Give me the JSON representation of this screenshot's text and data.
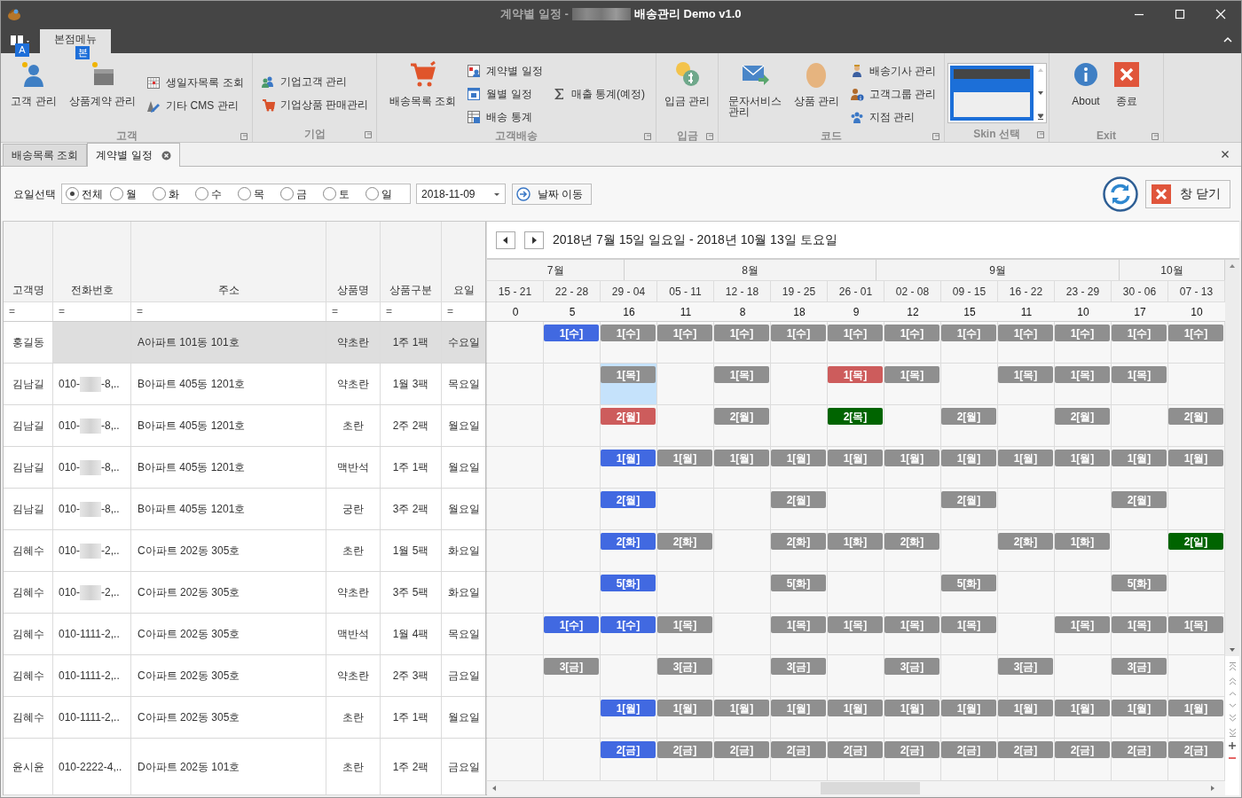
{
  "window": {
    "title_parts": [
      "계약별 일정 -",
      "배송관리 Demo v1.0"
    ]
  },
  "ribbon": {
    "app_menu_keytip": "A",
    "tabs": [
      {
        "label": "본점메뉴",
        "selected": true,
        "keytip": "본"
      }
    ],
    "groups": [
      {
        "label": "고객",
        "columns": [
          [
            {
              "kind": "large",
              "label": "고객 관리"
            }
          ],
          [
            {
              "kind": "large",
              "label": "상품계약 관리"
            }
          ],
          [
            {
              "kind": "small",
              "label": "생일자목록 조회"
            },
            {
              "kind": "small",
              "label": "기타 CMS 관리"
            }
          ]
        ]
      },
      {
        "label": "기업",
        "columns": [
          [
            {
              "kind": "small",
              "label": "기업고객 관리"
            },
            {
              "kind": "small",
              "label": "기업상품 판매관리"
            }
          ]
        ]
      },
      {
        "label": "고객배송",
        "columns": [
          [
            {
              "kind": "large",
              "label": "배송목록 조회"
            }
          ],
          [
            {
              "kind": "small",
              "label": "계약별 일정"
            },
            {
              "kind": "small",
              "label": "월별 일정"
            },
            {
              "kind": "small",
              "label": "배송 통계"
            }
          ],
          [
            {
              "kind": "small",
              "label": "매출 통계(예정)"
            }
          ]
        ]
      },
      {
        "label": "입금",
        "columns": [
          [
            {
              "kind": "large",
              "label": "입금 관리"
            }
          ]
        ]
      },
      {
        "label": "코드",
        "columns": [
          [
            {
              "kind": "large",
              "label": "문자서비스\n관리"
            }
          ],
          [
            {
              "kind": "large",
              "label": "상품 관리"
            }
          ],
          [
            {
              "kind": "small",
              "label": "배송기사 관리"
            },
            {
              "kind": "small",
              "label": "고객그룹 관리"
            },
            {
              "kind": "small",
              "label": "지점 관리"
            }
          ]
        ]
      },
      {
        "label": "Skin 선택",
        "columns": [
          [
            {
              "kind": "skin"
            }
          ]
        ]
      },
      {
        "label": "Exit",
        "columns": [
          [
            {
              "kind": "large",
              "label": "About"
            }
          ],
          [
            {
              "kind": "large",
              "label": "종료"
            }
          ]
        ]
      }
    ]
  },
  "doc_tabs": [
    {
      "label": "배송목록 조회",
      "selected": false,
      "closable": false
    },
    {
      "label": "계약별 일정",
      "selected": true,
      "closable": true
    }
  ],
  "toolbar": {
    "day_label": "요일선택",
    "days": [
      {
        "label": "전체",
        "checked": true
      },
      {
        "label": "월",
        "checked": false
      },
      {
        "label": "화",
        "checked": false
      },
      {
        "label": "수",
        "checked": false
      },
      {
        "label": "목",
        "checked": false
      },
      {
        "label": "금",
        "checked": false
      },
      {
        "label": "토",
        "checked": false
      },
      {
        "label": "일",
        "checked": false
      }
    ],
    "date": "2018-11-09",
    "go_button": "날짜 이동",
    "close_button": "창 닫기"
  },
  "table": {
    "columns": [
      {
        "label": "고객명",
        "filter": "="
      },
      {
        "label": "전화번호",
        "filter": "="
      },
      {
        "label": "주소",
        "filter": "="
      },
      {
        "label": "상품명",
        "filter": "="
      },
      {
        "label": "상품구분",
        "filter": "="
      },
      {
        "label": "요일",
        "filter": "="
      }
    ],
    "rows": [
      {
        "selected": true,
        "name": "홍길동",
        "address": "A아파트 101동 101호",
        "product": "약초란",
        "plan": "1주 1팩",
        "day": "수요일"
      },
      {
        "selected": false,
        "name": "김남길",
        "phone": [
          "010-",
          "-8,.."
        ],
        "address": "B아파트 405동 1201호",
        "product": "약초란",
        "plan": "1월 3팩",
        "day": "목요일"
      },
      {
        "selected": false,
        "name": "김남길",
        "phone": [
          "010-",
          "-8,.."
        ],
        "address": "B아파트 405동 1201호",
        "product": "초란",
        "plan": "2주 2팩",
        "day": "월요일"
      },
      {
        "selected": false,
        "name": "김남길",
        "phone": [
          "010-",
          "-8,.."
        ],
        "address": "B아파트 405동 1201호",
        "product": "맥반석",
        "plan": "1주 1팩",
        "day": "월요일"
      },
      {
        "selected": false,
        "name": "김남길",
        "phone": [
          "010-",
          "-8,.."
        ],
        "address": "B아파트 405동 1201호",
        "product": "궁란",
        "plan": "3주 2팩",
        "day": "월요일"
      },
      {
        "selected": false,
        "name": "김혜수",
        "phone": [
          "010-",
          "-2,.."
        ],
        "address": "C아파트 202동 305호",
        "product": "초란",
        "plan": "1월 5팩",
        "day": "화요일"
      },
      {
        "selected": false,
        "name": "김혜수",
        "phone": [
          "010-",
          "-2,.."
        ],
        "address": "C아파트 202동 305호",
        "product": "약초란",
        "plan": "3주 5팩",
        "day": "화요일"
      },
      {
        "selected": false,
        "name": "김혜수",
        "phone": [
          "010-1111-2,.."
        ],
        "address": "C아파트 202동 305호",
        "product": "맥반석",
        "plan": "1월 4팩",
        "day": "목요일"
      },
      {
        "selected": false,
        "name": "김혜수",
        "phone": [
          "010-1111-2,.."
        ],
        "address": "C아파트 202동 305호",
        "product": "약초란",
        "plan": "2주 3팩",
        "day": "금요일"
      },
      {
        "selected": false,
        "name": "김혜수",
        "phone": [
          "010-1111-2,.."
        ],
        "address": "C아파트 202동 305호",
        "product": "초란",
        "plan": "1주 1팩",
        "day": "월요일"
      },
      {
        "selected": false,
        "name": "윤시윤",
        "phone": [
          "010-2222-4,.."
        ],
        "address": "D아파트 202동 101호",
        "product": "초란",
        "plan": "1주 2팩",
        "day": "금요일"
      }
    ]
  },
  "schedule": {
    "range": "2018년 7월 15일 일요일 - 2018년 10월 13일 토요일",
    "months": [
      "7월",
      "8월",
      "9월",
      "10월"
    ],
    "weeks": [
      {
        "label": "15 - 21",
        "count": "0"
      },
      {
        "label": "22 - 28",
        "count": "5"
      },
      {
        "label": "29 - 04",
        "count": "16"
      },
      {
        "label": "05 - 11",
        "count": "11"
      },
      {
        "label": "12 - 18",
        "count": "8"
      },
      {
        "label": "19 - 25",
        "count": "18"
      },
      {
        "label": "26 - 01",
        "count": "9"
      },
      {
        "label": "02 - 08",
        "count": "12"
      },
      {
        "label": "09 - 15",
        "count": "15"
      },
      {
        "label": "16 - 22",
        "count": "11"
      },
      {
        "label": "23 - 29",
        "count": "10"
      },
      {
        "label": "30 - 06",
        "count": "17"
      },
      {
        "label": "07 - 13",
        "count": "10"
      }
    ],
    "rows": [
      {
        "cells": [
          {
            "kind": "empty",
            "selected": false
          },
          {
            "kind": "entry",
            "label": "1[수]",
            "color": "#4169e1",
            "selected": false
          },
          {
            "kind": "entry",
            "label": "1[수]",
            "color": "#8f8f8f",
            "selected": false
          },
          {
            "kind": "entry",
            "label": "1[수]",
            "color": "#8f8f8f",
            "selected": false
          },
          {
            "kind": "entry",
            "label": "1[수]",
            "color": "#8f8f8f",
            "selected": false
          },
          {
            "kind": "entry",
            "label": "1[수]",
            "color": "#8f8f8f",
            "selected": false
          },
          {
            "kind": "entry",
            "label": "1[수]",
            "color": "#8f8f8f",
            "selected": false
          },
          {
            "kind": "entry",
            "label": "1[수]",
            "color": "#8f8f8f",
            "selected": false
          },
          {
            "kind": "entry",
            "label": "1[수]",
            "color": "#8f8f8f",
            "selected": false
          },
          {
            "kind": "entry",
            "label": "1[수]",
            "color": "#8f8f8f",
            "selected": false
          },
          {
            "kind": "entry",
            "label": "1[수]",
            "color": "#8f8f8f",
            "selected": false
          },
          {
            "kind": "entry",
            "label": "1[수]",
            "color": "#8f8f8f",
            "selected": false
          },
          {
            "kind": "entry",
            "label": "1[수]",
            "color": "#8f8f8f",
            "selected": false
          }
        ]
      },
      {
        "cells": [
          {
            "kind": "empty",
            "selected": false
          },
          {
            "kind": "empty",
            "selected": false
          },
          {
            "kind": "entry",
            "label": "1[목]",
            "color": "#8f8f8f",
            "selected": true
          },
          {
            "kind": "empty",
            "selected": false
          },
          {
            "kind": "entry",
            "label": "1[목]",
            "color": "#8f8f8f",
            "selected": false
          },
          {
            "kind": "empty",
            "selected": false
          },
          {
            "kind": "entry",
            "label": "1[목]",
            "color": "#cd5c5c",
            "selected": false
          },
          {
            "kind": "entry",
            "label": "1[목]",
            "color": "#8f8f8f",
            "selected": false
          },
          {
            "kind": "empty",
            "selected": false
          },
          {
            "kind": "entry",
            "label": "1[목]",
            "color": "#8f8f8f",
            "selected": false
          },
          {
            "kind": "entry",
            "label": "1[목]",
            "color": "#8f8f8f",
            "selected": false
          },
          {
            "kind": "entry",
            "label": "1[목]",
            "color": "#8f8f8f",
            "selected": false
          },
          {
            "kind": "empty",
            "selected": false
          }
        ]
      },
      {
        "cells": [
          {
            "kind": "empty",
            "selected": false
          },
          {
            "kind": "empty",
            "selected": false
          },
          {
            "kind": "entry",
            "label": "2[월]",
            "color": "#cd5c5c",
            "selected": false
          },
          {
            "kind": "empty",
            "selected": false
          },
          {
            "kind": "entry",
            "label": "2[월]",
            "color": "#8f8f8f",
            "selected": false
          },
          {
            "kind": "empty",
            "selected": false
          },
          {
            "kind": "entry",
            "label": "2[목]",
            "color": "#006400",
            "selected": false
          },
          {
            "kind": "empty",
            "selected": false
          },
          {
            "kind": "entry",
            "label": "2[월]",
            "color": "#8f8f8f",
            "selected": false
          },
          {
            "kind": "empty",
            "selected": false
          },
          {
            "kind": "entry",
            "label": "2[월]",
            "color": "#8f8f8f",
            "selected": false
          },
          {
            "kind": "empty",
            "selected": false
          },
          {
            "kind": "entry",
            "label": "2[월]",
            "color": "#8f8f8f",
            "selected": false
          }
        ]
      },
      {
        "cells": [
          {
            "kind": "empty",
            "selected": false
          },
          {
            "kind": "empty",
            "selected": false
          },
          {
            "kind": "entry",
            "label": "1[월]",
            "color": "#4169e1",
            "selected": false
          },
          {
            "kind": "entry",
            "label": "1[월]",
            "color": "#8f8f8f",
            "selected": false
          },
          {
            "kind": "entry",
            "label": "1[월]",
            "color": "#8f8f8f",
            "selected": false
          },
          {
            "kind": "entry",
            "label": "1[월]",
            "color": "#8f8f8f",
            "selected": false
          },
          {
            "kind": "entry",
            "label": "1[월]",
            "color": "#8f8f8f",
            "selected": false
          },
          {
            "kind": "entry",
            "label": "1[월]",
            "color": "#8f8f8f",
            "selected": false
          },
          {
            "kind": "entry",
            "label": "1[월]",
            "color": "#8f8f8f",
            "selected": false
          },
          {
            "kind": "entry",
            "label": "1[월]",
            "color": "#8f8f8f",
            "selected": false
          },
          {
            "kind": "entry",
            "label": "1[월]",
            "color": "#8f8f8f",
            "selected": false
          },
          {
            "kind": "entry",
            "label": "1[월]",
            "color": "#8f8f8f",
            "selected": false
          },
          {
            "kind": "entry",
            "label": "1[월]",
            "color": "#8f8f8f",
            "selected": false
          }
        ]
      },
      {
        "cells": [
          {
            "kind": "empty",
            "selected": false
          },
          {
            "kind": "empty",
            "selected": false
          },
          {
            "kind": "entry",
            "label": "2[월]",
            "color": "#4169e1",
            "selected": false
          },
          {
            "kind": "empty",
            "selected": false
          },
          {
            "kind": "empty",
            "selected": false
          },
          {
            "kind": "entry",
            "label": "2[월]",
            "color": "#8f8f8f",
            "selected": false
          },
          {
            "kind": "empty",
            "selected": false
          },
          {
            "kind": "empty",
            "selected": false
          },
          {
            "kind": "entry",
            "label": "2[월]",
            "color": "#8f8f8f",
            "selected": false
          },
          {
            "kind": "empty",
            "selected": false
          },
          {
            "kind": "empty",
            "selected": false
          },
          {
            "kind": "entry",
            "label": "2[월]",
            "color": "#8f8f8f",
            "selected": false
          },
          {
            "kind": "empty",
            "selected": false
          }
        ]
      },
      {
        "cells": [
          {
            "kind": "empty",
            "selected": false
          },
          {
            "kind": "empty",
            "selected": false
          },
          {
            "kind": "entry",
            "label": "2[화]",
            "color": "#4169e1",
            "selected": false
          },
          {
            "kind": "entry",
            "label": "2[화]",
            "color": "#8f8f8f",
            "selected": false
          },
          {
            "kind": "empty",
            "selected": false
          },
          {
            "kind": "entry",
            "label": "2[화]",
            "color": "#8f8f8f",
            "selected": false
          },
          {
            "kind": "entry",
            "label": "1[화]",
            "color": "#8f8f8f",
            "selected": false
          },
          {
            "kind": "entry",
            "label": "2[화]",
            "color": "#8f8f8f",
            "selected": false
          },
          {
            "kind": "empty",
            "selected": false
          },
          {
            "kind": "entry",
            "label": "2[화]",
            "color": "#8f8f8f",
            "selected": false
          },
          {
            "kind": "entry",
            "label": "1[화]",
            "color": "#8f8f8f",
            "selected": false
          },
          {
            "kind": "empty",
            "selected": false
          },
          {
            "kind": "entry",
            "label": "2[일]",
            "color": "#006400",
            "selected": false
          }
        ]
      },
      {
        "cells": [
          {
            "kind": "empty",
            "selected": false
          },
          {
            "kind": "empty",
            "selected": false
          },
          {
            "kind": "entry",
            "label": "5[화]",
            "color": "#4169e1",
            "selected": false
          },
          {
            "kind": "empty",
            "selected": false
          },
          {
            "kind": "empty",
            "selected": false
          },
          {
            "kind": "entry",
            "label": "5[화]",
            "color": "#8f8f8f",
            "selected": false
          },
          {
            "kind": "empty",
            "selected": false
          },
          {
            "kind": "empty",
            "selected": false
          },
          {
            "kind": "entry",
            "label": "5[화]",
            "color": "#8f8f8f",
            "selected": false
          },
          {
            "kind": "empty",
            "selected": false
          },
          {
            "kind": "empty",
            "selected": false
          },
          {
            "kind": "entry",
            "label": "5[화]",
            "color": "#8f8f8f",
            "selected": false
          },
          {
            "kind": "empty",
            "selected": false
          }
        ]
      },
      {
        "cells": [
          {
            "kind": "empty",
            "selected": false
          },
          {
            "kind": "entry",
            "label": "1[수]",
            "color": "#4169e1",
            "selected": false
          },
          {
            "kind": "entry",
            "label": "1[수]",
            "color": "#4169e1",
            "selected": false
          },
          {
            "kind": "entry",
            "label": "1[목]",
            "color": "#8f8f8f",
            "selected": false
          },
          {
            "kind": "empty",
            "selected": false
          },
          {
            "kind": "entry",
            "label": "1[목]",
            "color": "#8f8f8f",
            "selected": false
          },
          {
            "kind": "entry",
            "label": "1[목]",
            "color": "#8f8f8f",
            "selected": false
          },
          {
            "kind": "entry",
            "label": "1[목]",
            "color": "#8f8f8f",
            "selected": false
          },
          {
            "kind": "entry",
            "label": "1[목]",
            "color": "#8f8f8f",
            "selected": false
          },
          {
            "kind": "empty",
            "selected": false
          },
          {
            "kind": "entry",
            "label": "1[목]",
            "color": "#8f8f8f",
            "selected": false
          },
          {
            "kind": "entry",
            "label": "1[목]",
            "color": "#8f8f8f",
            "selected": false
          },
          {
            "kind": "entry",
            "label": "1[목]",
            "color": "#8f8f8f",
            "selected": false
          }
        ]
      },
      {
        "cells": [
          {
            "kind": "empty",
            "selected": false
          },
          {
            "kind": "entry",
            "label": "3[금]",
            "color": "#8f8f8f",
            "selected": false
          },
          {
            "kind": "empty",
            "selected": false
          },
          {
            "kind": "entry",
            "label": "3[금]",
            "color": "#8f8f8f",
            "selected": false
          },
          {
            "kind": "empty",
            "selected": false
          },
          {
            "kind": "entry",
            "label": "3[금]",
            "color": "#8f8f8f",
            "selected": false
          },
          {
            "kind": "empty",
            "selected": false
          },
          {
            "kind": "entry",
            "label": "3[금]",
            "color": "#8f8f8f",
            "selected": false
          },
          {
            "kind": "empty",
            "selected": false
          },
          {
            "kind": "entry",
            "label": "3[금]",
            "color": "#8f8f8f",
            "selected": false
          },
          {
            "kind": "empty",
            "selected": false
          },
          {
            "kind": "entry",
            "label": "3[금]",
            "color": "#8f8f8f",
            "selected": false
          },
          {
            "kind": "empty",
            "selected": false
          }
        ]
      },
      {
        "cells": [
          {
            "kind": "empty",
            "selected": false
          },
          {
            "kind": "empty",
            "selected": false
          },
          {
            "kind": "entry",
            "label": "1[월]",
            "color": "#4169e1",
            "selected": false
          },
          {
            "kind": "entry",
            "label": "1[월]",
            "color": "#8f8f8f",
            "selected": false
          },
          {
            "kind": "entry",
            "label": "1[월]",
            "color": "#8f8f8f",
            "selected": false
          },
          {
            "kind": "entry",
            "label": "1[월]",
            "color": "#8f8f8f",
            "selected": false
          },
          {
            "kind": "entry",
            "label": "1[월]",
            "color": "#8f8f8f",
            "selected": false
          },
          {
            "kind": "entry",
            "label": "1[월]",
            "color": "#8f8f8f",
            "selected": false
          },
          {
            "kind": "entry",
            "label": "1[월]",
            "color": "#8f8f8f",
            "selected": false
          },
          {
            "kind": "entry",
            "label": "1[월]",
            "color": "#8f8f8f",
            "selected": false
          },
          {
            "kind": "entry",
            "label": "1[월]",
            "color": "#8f8f8f",
            "selected": false
          },
          {
            "kind": "entry",
            "label": "1[월]",
            "color": "#8f8f8f",
            "selected": false
          },
          {
            "kind": "entry",
            "label": "1[월]",
            "color": "#8f8f8f",
            "selected": false
          }
        ]
      },
      {
        "cells": [
          {
            "kind": "empty",
            "selected": false
          },
          {
            "kind": "empty",
            "selected": false
          },
          {
            "kind": "entry",
            "label": "2[금]",
            "color": "#4169e1",
            "selected": false
          },
          {
            "kind": "entry",
            "label": "2[금]",
            "color": "#8f8f8f",
            "selected": false
          },
          {
            "kind": "entry",
            "label": "2[금]",
            "color": "#8f8f8f",
            "selected": false
          },
          {
            "kind": "entry",
            "label": "2[금]",
            "color": "#8f8f8f",
            "selected": false
          },
          {
            "kind": "entry",
            "label": "2[금]",
            "color": "#8f8f8f",
            "selected": false
          },
          {
            "kind": "entry",
            "label": "2[금]",
            "color": "#8f8f8f",
            "selected": false
          },
          {
            "kind": "entry",
            "label": "2[금]",
            "color": "#8f8f8f",
            "selected": false
          },
          {
            "kind": "entry",
            "label": "2[금]",
            "color": "#8f8f8f",
            "selected": false
          },
          {
            "kind": "entry",
            "label": "2[금]",
            "color": "#8f8f8f",
            "selected": false
          },
          {
            "kind": "entry",
            "label": "2[금]",
            "color": "#8f8f8f",
            "selected": false
          },
          {
            "kind": "entry",
            "label": "2[금]",
            "color": "#8f8f8f",
            "selected": false
          }
        ]
      }
    ]
  }
}
